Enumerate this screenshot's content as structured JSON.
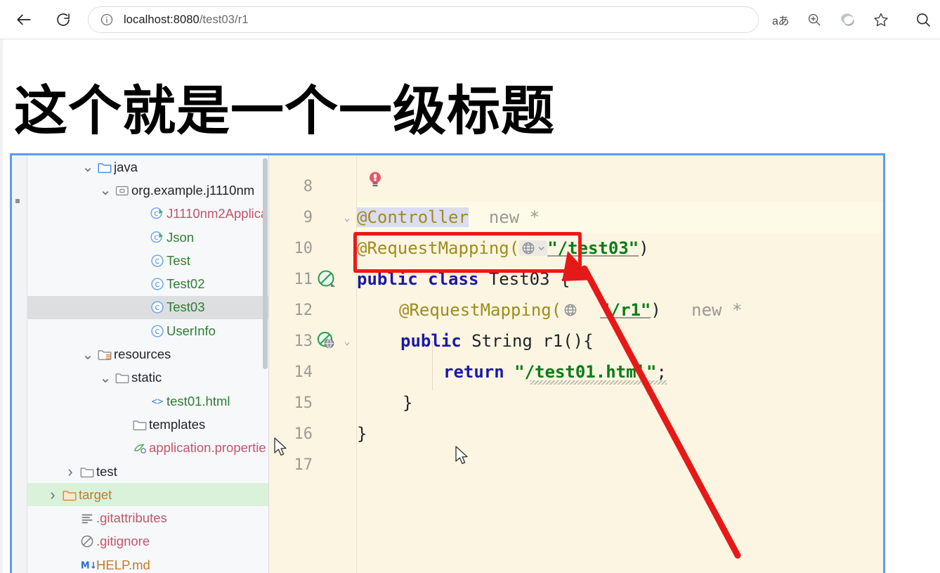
{
  "browser": {
    "back_label": "Back",
    "refresh_label": "Refresh",
    "info_label": "Site information",
    "url_host": "localhost:8080",
    "url_path": "/test03/r1",
    "url_full": "localhost:8080/test03/r1",
    "actions": [
      {
        "name": "translate-icon",
        "label": "aあ"
      },
      {
        "name": "zoom-in-icon",
        "label": ""
      },
      {
        "name": "copilot-icon",
        "label": ""
      },
      {
        "name": "favorite-star-icon",
        "label": ""
      }
    ],
    "search_label": "Search"
  },
  "page": {
    "heading": "这个就是一个一级标题"
  },
  "ide": {
    "tree": [
      {
        "indent": 3,
        "twist": "v",
        "icon": "folder-blue",
        "label": "java",
        "color": "dark",
        "state": ""
      },
      {
        "indent": 4,
        "twist": "v",
        "icon": "package",
        "label": "org.example.j1110nm",
        "color": "dark",
        "state": ""
      },
      {
        "indent": 6,
        "twist": "",
        "icon": "class-run",
        "label": "J1110nm2Applica",
        "color": "red",
        "state": ""
      },
      {
        "indent": 6,
        "twist": "",
        "icon": "class-run",
        "label": "Json",
        "color": "green",
        "state": ""
      },
      {
        "indent": 6,
        "twist": "",
        "icon": "class",
        "label": "Test",
        "color": "green",
        "state": ""
      },
      {
        "indent": 6,
        "twist": "",
        "icon": "class",
        "label": "Test02",
        "color": "green",
        "state": ""
      },
      {
        "indent": 6,
        "twist": "",
        "icon": "class",
        "label": "Test03",
        "color": "green",
        "state": "selected"
      },
      {
        "indent": 6,
        "twist": "",
        "icon": "class",
        "label": "UserInfo",
        "color": "green",
        "state": ""
      },
      {
        "indent": 3,
        "twist": "v",
        "icon": "folder-resources",
        "label": "resources",
        "color": "dark",
        "state": ""
      },
      {
        "indent": 4,
        "twist": "v",
        "icon": "folder",
        "label": "static",
        "color": "dark",
        "state": ""
      },
      {
        "indent": 6,
        "twist": "",
        "icon": "html",
        "label": "test01.html",
        "color": "green",
        "state": ""
      },
      {
        "indent": 5,
        "twist": "",
        "icon": "folder",
        "label": "templates",
        "color": "dark",
        "state": ""
      },
      {
        "indent": 5,
        "twist": "",
        "icon": "properties",
        "label": "application.propertie",
        "color": "red",
        "state": ""
      },
      {
        "indent": 2,
        "twist": ">",
        "icon": "folder",
        "label": "test",
        "color": "dark",
        "state": ""
      },
      {
        "indent": 1,
        "twist": ">",
        "icon": "folder-orange",
        "label": "target",
        "color": "orange",
        "state": "green-selected"
      },
      {
        "indent": 2,
        "twist": "",
        "icon": "gitattributes",
        "label": ".gitattributes",
        "color": "red",
        "state": ""
      },
      {
        "indent": 2,
        "twist": "",
        "icon": "gitignore",
        "label": ".gitignore",
        "color": "red",
        "state": ""
      },
      {
        "indent": 2,
        "twist": "",
        "icon": "markdown",
        "label": "HELP.md",
        "color": "orange",
        "state": ""
      }
    ],
    "editor": {
      "lines": [
        {
          "num": "8",
          "gutter": "",
          "fold": "",
          "highlight": false
        },
        {
          "num": "9",
          "gutter": "",
          "fold": "v",
          "highlight": true
        },
        {
          "num": "10",
          "gutter": "",
          "fold": "",
          "highlight": false
        },
        {
          "num": "11",
          "gutter": "run",
          "fold": "",
          "highlight": false
        },
        {
          "num": "12",
          "gutter": "",
          "fold": "",
          "highlight": false
        },
        {
          "num": "13",
          "gutter": "run-web",
          "fold": "v",
          "highlight": false
        },
        {
          "num": "14",
          "gutter": "",
          "fold": "",
          "highlight": false
        },
        {
          "num": "15",
          "gutter": "",
          "fold": "",
          "highlight": false
        },
        {
          "num": "16",
          "gutter": "",
          "fold": "",
          "highlight": false
        },
        {
          "num": "17",
          "gutter": "",
          "fold": "",
          "highlight": false
        }
      ],
      "code": {
        "l9_annotation": "@Controller",
        "l9_hint": "new *",
        "l10_annotation": "@RequestMapping(",
        "l10_value": "\"/test03\"",
        "l10_close": ")",
        "l11_kw1": "public",
        "l11_kw2": "class",
        "l11_name": "Test03",
        "l11_brace": "{",
        "l12_annotation": "@RequestMapping(",
        "l12_value": "\"/r1\"",
        "l12_close": ")",
        "l12_hint": "new *",
        "l13_kw": "public",
        "l13_type": "String",
        "l13_sig": "r1(){",
        "l14_kw": "return",
        "l14_value": "\"/test01.html\"",
        "l14_semi": ";",
        "l15_brace": "}",
        "l16_brace": "}"
      },
      "bulb_icon": "intention-bulb-error"
    }
  },
  "annotations": {
    "highlight_box": "red-rectangle-around-controller",
    "arrow": "red-arrow-pointing-to-requestmapping-globe"
  }
}
